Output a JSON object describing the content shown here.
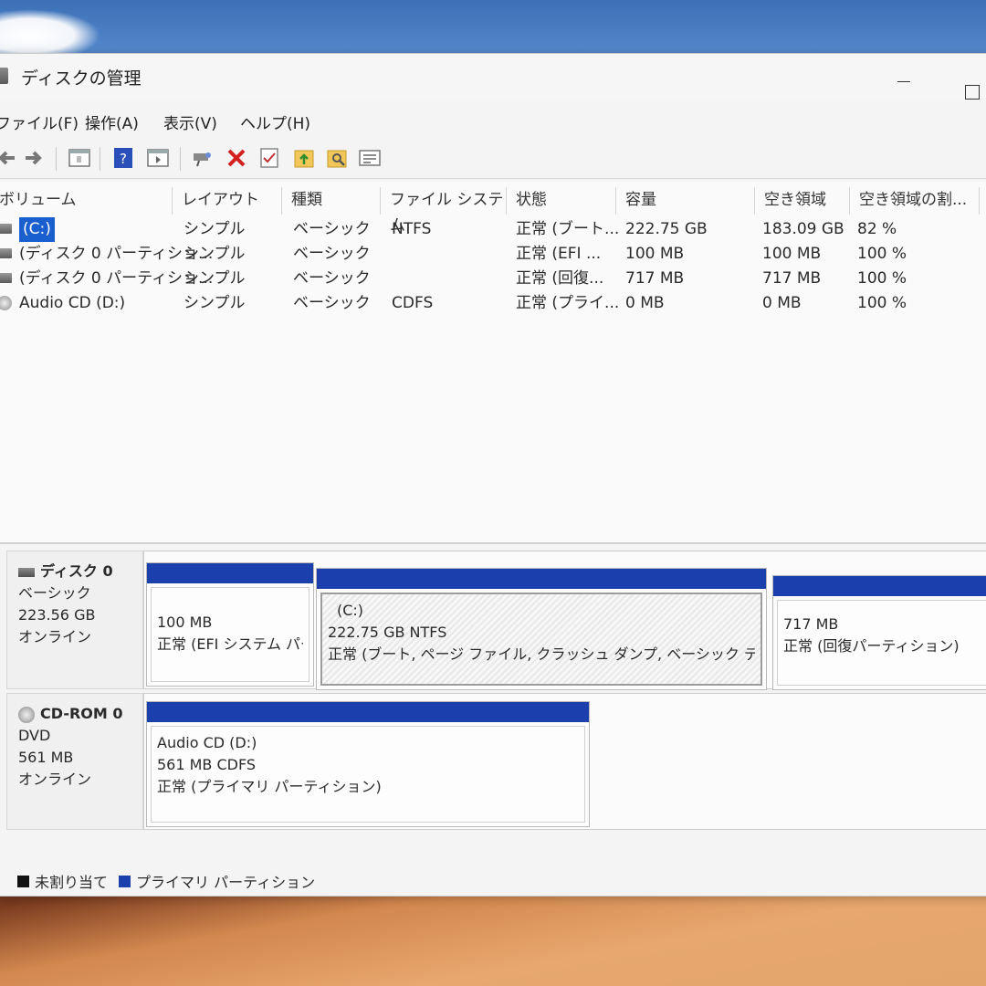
{
  "window": {
    "title": "ディスクの管理"
  },
  "menu": [
    "ファイル(F)",
    "操作(A)",
    "表示(V)",
    "ヘルプ(H)"
  ],
  "toolbar": [
    "back-arrow-icon",
    "forward-arrow-icon",
    "console-tree-icon",
    "help-icon",
    "action-pane-icon",
    "connect-drive-icon",
    "delete-icon",
    "check-icon",
    "folder-up-icon",
    "search-folder-icon",
    "properties-icon"
  ],
  "table": {
    "columns": [
      "ボリューム",
      "レイアウト",
      "種類",
      "ファイル システム",
      "状態",
      "容量",
      "空き領域",
      "空き領域の割..."
    ],
    "rows": [
      {
        "volume": "(C:)",
        "layout": "シンプル",
        "type": "ベーシック",
        "fs": "NTFS",
        "status": "正常 (ブート...",
        "capacity": "222.75 GB",
        "free": "183.09 GB",
        "pct": "82 %",
        "icon": "drive"
      },
      {
        "volume": "(ディスク 0 パーティショ...",
        "layout": "シンプル",
        "type": "ベーシック",
        "fs": "",
        "status": "正常 (EFI ...",
        "capacity": "100 MB",
        "free": "100 MB",
        "pct": "100 %",
        "icon": "drive"
      },
      {
        "volume": "(ディスク 0 パーティショ...",
        "layout": "シンプル",
        "type": "ベーシック",
        "fs": "",
        "status": "正常 (回復...",
        "capacity": "717 MB",
        "free": "717 MB",
        "pct": "100 %",
        "icon": "drive"
      },
      {
        "volume": "Audio CD (D:)",
        "layout": "シンプル",
        "type": "ベーシック",
        "fs": "CDFS",
        "status": "正常 (プライ...",
        "capacity": "0 MB",
        "free": "0 MB",
        "pct": "100 %",
        "icon": "cd"
      }
    ]
  },
  "disks": [
    {
      "name": "ディスク 0",
      "kind": "ベーシック",
      "size": "223.56 GB",
      "state": "オンライン",
      "partitions": [
        {
          "label": "",
          "line1": "100 MB",
          "line2": "正常 (EFI システム パーテ"
        },
        {
          "label": "(C:)",
          "line1": "222.75 GB NTFS",
          "line2": "正常 (ブート, ページ ファイル, クラッシュ ダンプ, ベーシック データ パーティシ"
        },
        {
          "label": "",
          "line1": "717 MB",
          "line2": "正常 (回復パーティション)"
        }
      ]
    },
    {
      "name": "CD-ROM 0",
      "kind": "DVD",
      "size": "561 MB",
      "state": "オンライン",
      "partitions": [
        {
          "label": "Audio CD  (D:)",
          "line1": "561 MB CDFS",
          "line2": "正常 (プライマリ パーティション)"
        }
      ]
    }
  ],
  "legend": [
    {
      "label": "未割り当て",
      "color": "#111111"
    },
    {
      "label": "プライマリ パーティション",
      "color": "#1c3fae"
    }
  ]
}
